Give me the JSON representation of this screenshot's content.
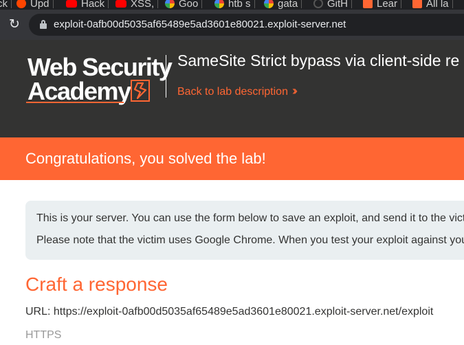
{
  "browser": {
    "bookmarks": [
      {
        "label": "ck",
        "icon": "bookmark-icon"
      },
      {
        "label": "Upd",
        "icon": "reddit-icon"
      },
      {
        "label": "Hack",
        "icon": "youtube-icon"
      },
      {
        "label": "XSS,",
        "icon": "youtube-icon"
      },
      {
        "label": "Goo",
        "icon": "google-icon"
      },
      {
        "label": "htb s",
        "icon": "google-icon"
      },
      {
        "label": "gata",
        "icon": "google-icon"
      },
      {
        "label": "GitH",
        "icon": "github-icon"
      },
      {
        "label": "Lear",
        "icon": "portswigger-icon"
      },
      {
        "label": "All la",
        "icon": "portswigger-icon"
      }
    ],
    "address": "exploit-0afb00d5035af65489e5ad3601e80021.exploit-server.net"
  },
  "header": {
    "logo_line1": "Web Security",
    "logo_line2": "Academy",
    "lab_title": "SameSite Strict bypass via client-side re",
    "back_link": "Back to lab description"
  },
  "banner": {
    "text": "Congratulations, you solved the lab!"
  },
  "info": {
    "line1": "This is your server. You can use the form below to save an exploit, and send it to the vict",
    "line2": "Please note that the victim uses Google Chrome. When you test your exploit against you"
  },
  "form": {
    "section_title": "Craft a response",
    "url_line": "URL: https://exploit-0afb00d5035af65489e5ad3601e80021.exploit-server.net/exploit",
    "https_label": "HTTPS"
  },
  "colors": {
    "accent": "#ff6633",
    "header_bg": "#333332",
    "info_bg": "#eaeff1"
  }
}
